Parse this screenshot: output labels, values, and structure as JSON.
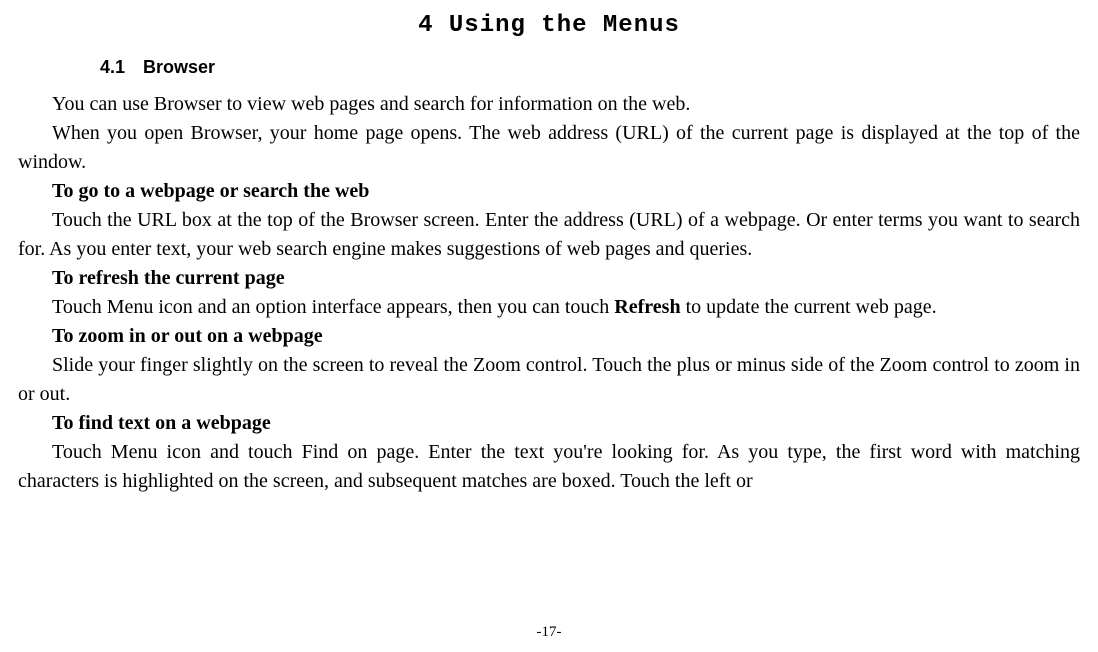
{
  "chapter": {
    "title": "4 Using the Menus"
  },
  "section": {
    "number": "4.1",
    "title": "Browser"
  },
  "paragraphs": {
    "p1": "You can use Browser to view web pages and search for information on the web.",
    "p2": "When you open Browser, your home page opens. The web address (URL) of the current page is displayed at the top of the window.",
    "h1": "To go to a webpage or search the web",
    "p3": "Touch the URL box at the top of the Browser screen. Enter the address (URL) of a webpage. Or enter terms you want to search for. As you enter text, your web search engine makes suggestions of web pages and queries.",
    "h2": "To refresh the current page",
    "p4a": "Touch Menu icon and an option interface appears, then you can touch ",
    "p4b": "Refresh",
    "p4c": " to update the current web page.",
    "h3": "To zoom in or out on a webpage",
    "p5": "Slide your finger slightly on the screen to reveal the Zoom control. Touch the plus or minus side of the Zoom control to zoom in or out.",
    "h4": "To find text on a webpage",
    "p6": "Touch Menu icon and touch Find on page. Enter the text you're looking for. As you type, the first word with matching characters is highlighted on the screen, and subsequent matches are boxed. Touch the left or"
  },
  "page_number": "-17-"
}
